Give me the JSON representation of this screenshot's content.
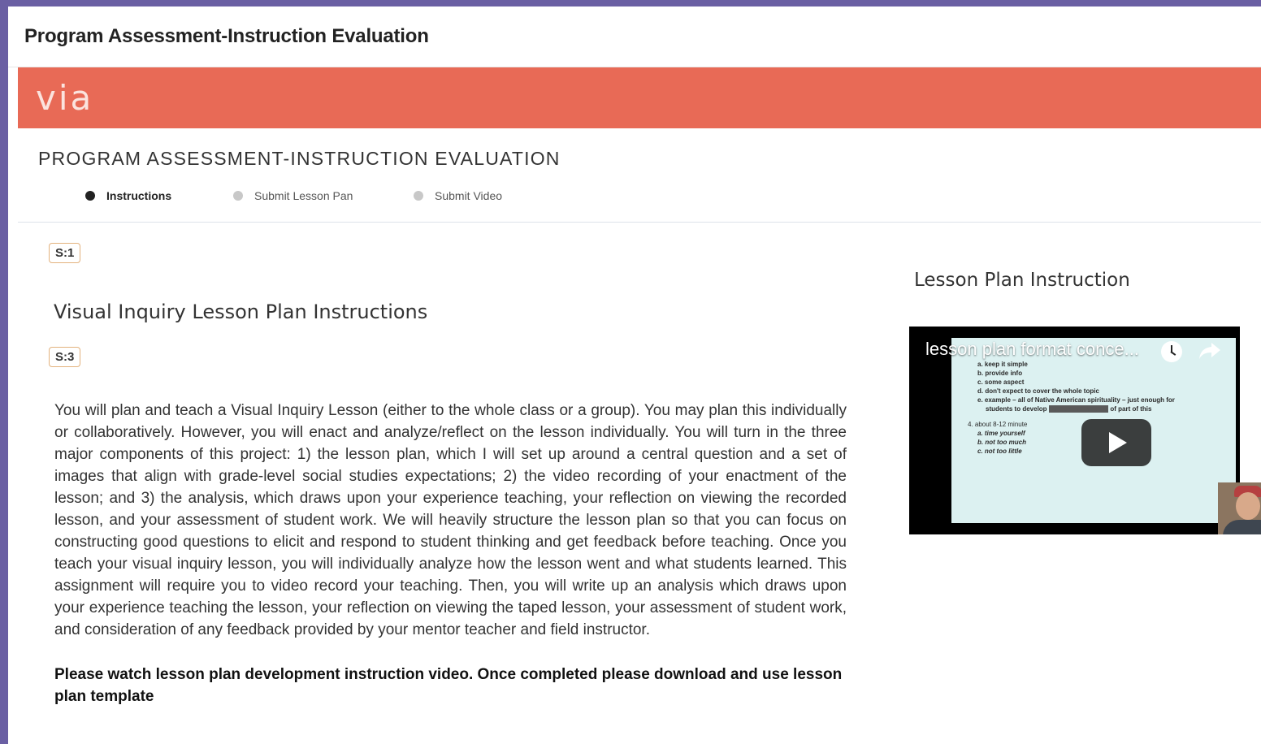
{
  "window": {
    "title": "Program Assessment-Instruction Evaluation"
  },
  "brand": {
    "logo_text": "via",
    "color": "#e86a56"
  },
  "section": {
    "title": "PROGRAM ASSESSMENT-INSTRUCTION EVALUATION"
  },
  "steps": [
    {
      "label": "Instructions",
      "active": true
    },
    {
      "label": "Submit Lesson Pan",
      "active": false
    },
    {
      "label": "Submit Video",
      "active": false
    }
  ],
  "tags": {
    "s1": "S:1",
    "s3": "S:3"
  },
  "lesson": {
    "heading": "Visual Inquiry Lesson Plan Instructions",
    "body": "You will plan and teach a Visual Inquiry Lesson (either to the whole class or a group). You may plan this individually or collaboratively. However, you will enact and analyze/reflect on the lesson individually. You will turn in the three major components of this project: 1) the lesson plan, which I will set up around a central question and a set of images that align with grade-level social studies expectations; 2) the video recording of your enactment of the lesson; and 3) the analysis, which draws upon your experience teaching, your reflection on viewing the recorded lesson, and your assessment of student work. We will heavily structure the lesson plan so that you can focus on constructing good questions to elicit and respond to student thinking and get feedback before teaching. Once you teach your visual inquiry lesson, you will individually analyze how the lesson went and what students learned. This assignment will require you to video record your teaching.  Then, you will write up an analysis which draws upon your experience teaching the lesson, your reflection on viewing the taped lesson, your assessment of student work, and consideration of any feedback provided by your mentor teacher and field instructor.",
    "note": "Please watch lesson plan development instruction video. Once completed please download and use lesson plan template"
  },
  "video": {
    "section_title": "Lesson Plan Instruction",
    "overlay_title": "lesson plan format conce...",
    "slide_lines": [
      "a. keep it simple",
      "b. provide info",
      "c. some aspect",
      "d. don't expect to cover the whole topic",
      "e. example – all of Native American spirituality  – just enough for",
      "students to develop",
      "of part of this",
      "4. about 8-12 minute",
      "a. time yourself",
      "b. not too much",
      "c. not too little"
    ]
  }
}
